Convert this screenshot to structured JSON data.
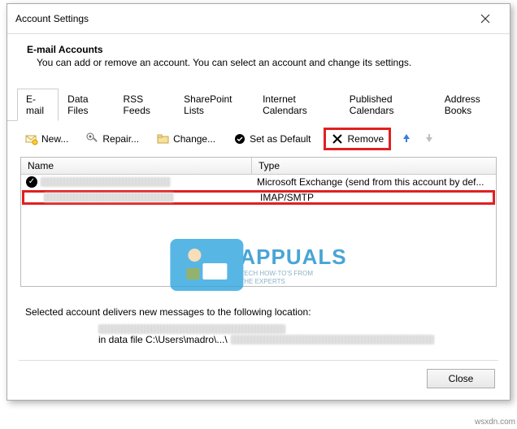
{
  "window": {
    "title": "Account Settings"
  },
  "header": {
    "title": "E-mail Accounts",
    "desc": "You can add or remove an account. You can select an account and change its settings."
  },
  "tabs": [
    {
      "label": "E-mail"
    },
    {
      "label": "Data Files"
    },
    {
      "label": "RSS Feeds"
    },
    {
      "label": "SharePoint Lists"
    },
    {
      "label": "Internet Calendars"
    },
    {
      "label": "Published Calendars"
    },
    {
      "label": "Address Books"
    }
  ],
  "toolbar": {
    "new": "New...",
    "repair": "Repair...",
    "change": "Change...",
    "set_default": "Set as Default",
    "remove": "Remove"
  },
  "table": {
    "col_name": "Name",
    "col_type": "Type",
    "rows": [
      {
        "type": "Microsoft Exchange (send from this account by def..."
      },
      {
        "type": "IMAP/SMTP"
      }
    ]
  },
  "location": {
    "line1": "Selected account delivers new messages to the following location:",
    "line3_prefix": "in data file C:\\Users\\madro\\...\\"
  },
  "footer": {
    "close": "Close"
  },
  "watermark": {
    "brand": "APPUALS",
    "tag1": "TECH HOW-TO'S FROM",
    "tag2": "THE EXPERTS"
  },
  "corner": "wsxdn.com"
}
